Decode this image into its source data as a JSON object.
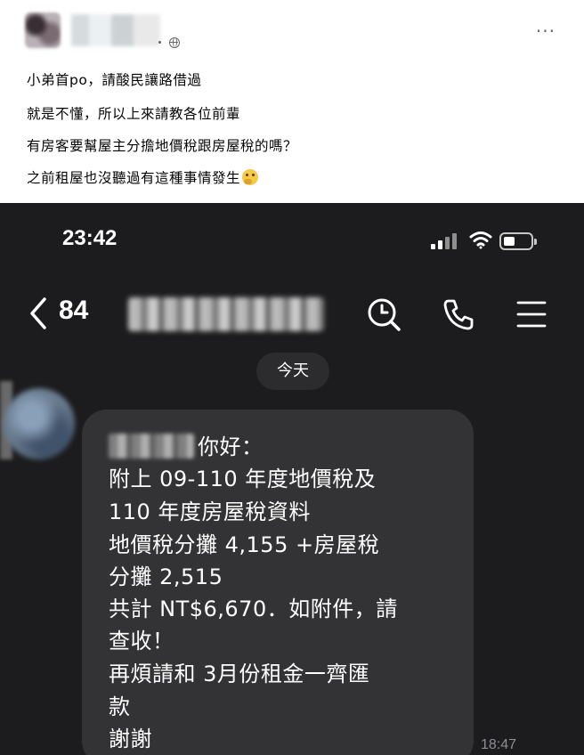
{
  "post": {
    "lines": [
      "小弟首po，請酸民讓路借過",
      "就是不懂，所以上來請教各位前輩",
      "有房客要幫屋主分擔地價稅跟房屋稅的嗎？",
      "之前租屋也沒聽過有這種事情發生"
    ],
    "emoji": "thinking-face",
    "menu_label": "···"
  },
  "phone": {
    "status_time": "23:42",
    "back_count": "84",
    "date_chip": "今天",
    "message": {
      "greeting": "你好：",
      "lines": [
        "附上 09-110 年度地價稅及",
        "110 年度房屋稅資料",
        "地價稅分攤 4,155 +房屋稅",
        "分攤 2,515",
        "共計 NT$6,670．如附件，請",
        "查收！",
        "再煩請和 3月份租金一齊匯",
        "款",
        "謝謝"
      ],
      "time": "18:47"
    }
  },
  "colors": {
    "phone_bg": "#1c1c1e",
    "bubble": "#333335",
    "text_light": "#ffffff",
    "post_text": "#050505"
  }
}
